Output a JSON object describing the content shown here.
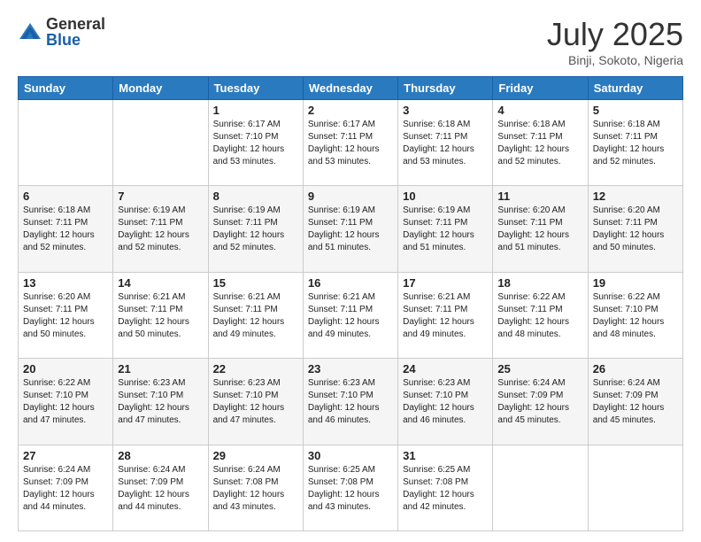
{
  "header": {
    "logo_general": "General",
    "logo_blue": "Blue",
    "month_title": "July 2025",
    "location": "Binji, Sokoto, Nigeria"
  },
  "days_of_week": [
    "Sunday",
    "Monday",
    "Tuesday",
    "Wednesday",
    "Thursday",
    "Friday",
    "Saturday"
  ],
  "weeks": [
    [
      {
        "day": "",
        "sunrise": "",
        "sunset": "",
        "daylight": ""
      },
      {
        "day": "",
        "sunrise": "",
        "sunset": "",
        "daylight": ""
      },
      {
        "day": "1",
        "sunrise": "Sunrise: 6:17 AM",
        "sunset": "Sunset: 7:10 PM",
        "daylight": "Daylight: 12 hours and 53 minutes."
      },
      {
        "day": "2",
        "sunrise": "Sunrise: 6:17 AM",
        "sunset": "Sunset: 7:11 PM",
        "daylight": "Daylight: 12 hours and 53 minutes."
      },
      {
        "day": "3",
        "sunrise": "Sunrise: 6:18 AM",
        "sunset": "Sunset: 7:11 PM",
        "daylight": "Daylight: 12 hours and 53 minutes."
      },
      {
        "day": "4",
        "sunrise": "Sunrise: 6:18 AM",
        "sunset": "Sunset: 7:11 PM",
        "daylight": "Daylight: 12 hours and 52 minutes."
      },
      {
        "day": "5",
        "sunrise": "Sunrise: 6:18 AM",
        "sunset": "Sunset: 7:11 PM",
        "daylight": "Daylight: 12 hours and 52 minutes."
      }
    ],
    [
      {
        "day": "6",
        "sunrise": "Sunrise: 6:18 AM",
        "sunset": "Sunset: 7:11 PM",
        "daylight": "Daylight: 12 hours and 52 minutes."
      },
      {
        "day": "7",
        "sunrise": "Sunrise: 6:19 AM",
        "sunset": "Sunset: 7:11 PM",
        "daylight": "Daylight: 12 hours and 52 minutes."
      },
      {
        "day": "8",
        "sunrise": "Sunrise: 6:19 AM",
        "sunset": "Sunset: 7:11 PM",
        "daylight": "Daylight: 12 hours and 52 minutes."
      },
      {
        "day": "9",
        "sunrise": "Sunrise: 6:19 AM",
        "sunset": "Sunset: 7:11 PM",
        "daylight": "Daylight: 12 hours and 51 minutes."
      },
      {
        "day": "10",
        "sunrise": "Sunrise: 6:19 AM",
        "sunset": "Sunset: 7:11 PM",
        "daylight": "Daylight: 12 hours and 51 minutes."
      },
      {
        "day": "11",
        "sunrise": "Sunrise: 6:20 AM",
        "sunset": "Sunset: 7:11 PM",
        "daylight": "Daylight: 12 hours and 51 minutes."
      },
      {
        "day": "12",
        "sunrise": "Sunrise: 6:20 AM",
        "sunset": "Sunset: 7:11 PM",
        "daylight": "Daylight: 12 hours and 50 minutes."
      }
    ],
    [
      {
        "day": "13",
        "sunrise": "Sunrise: 6:20 AM",
        "sunset": "Sunset: 7:11 PM",
        "daylight": "Daylight: 12 hours and 50 minutes."
      },
      {
        "day": "14",
        "sunrise": "Sunrise: 6:21 AM",
        "sunset": "Sunset: 7:11 PM",
        "daylight": "Daylight: 12 hours and 50 minutes."
      },
      {
        "day": "15",
        "sunrise": "Sunrise: 6:21 AM",
        "sunset": "Sunset: 7:11 PM",
        "daylight": "Daylight: 12 hours and 49 minutes."
      },
      {
        "day": "16",
        "sunrise": "Sunrise: 6:21 AM",
        "sunset": "Sunset: 7:11 PM",
        "daylight": "Daylight: 12 hours and 49 minutes."
      },
      {
        "day": "17",
        "sunrise": "Sunrise: 6:21 AM",
        "sunset": "Sunset: 7:11 PM",
        "daylight": "Daylight: 12 hours and 49 minutes."
      },
      {
        "day": "18",
        "sunrise": "Sunrise: 6:22 AM",
        "sunset": "Sunset: 7:11 PM",
        "daylight": "Daylight: 12 hours and 48 minutes."
      },
      {
        "day": "19",
        "sunrise": "Sunrise: 6:22 AM",
        "sunset": "Sunset: 7:10 PM",
        "daylight": "Daylight: 12 hours and 48 minutes."
      }
    ],
    [
      {
        "day": "20",
        "sunrise": "Sunrise: 6:22 AM",
        "sunset": "Sunset: 7:10 PM",
        "daylight": "Daylight: 12 hours and 47 minutes."
      },
      {
        "day": "21",
        "sunrise": "Sunrise: 6:23 AM",
        "sunset": "Sunset: 7:10 PM",
        "daylight": "Daylight: 12 hours and 47 minutes."
      },
      {
        "day": "22",
        "sunrise": "Sunrise: 6:23 AM",
        "sunset": "Sunset: 7:10 PM",
        "daylight": "Daylight: 12 hours and 47 minutes."
      },
      {
        "day": "23",
        "sunrise": "Sunrise: 6:23 AM",
        "sunset": "Sunset: 7:10 PM",
        "daylight": "Daylight: 12 hours and 46 minutes."
      },
      {
        "day": "24",
        "sunrise": "Sunrise: 6:23 AM",
        "sunset": "Sunset: 7:10 PM",
        "daylight": "Daylight: 12 hours and 46 minutes."
      },
      {
        "day": "25",
        "sunrise": "Sunrise: 6:24 AM",
        "sunset": "Sunset: 7:09 PM",
        "daylight": "Daylight: 12 hours and 45 minutes."
      },
      {
        "day": "26",
        "sunrise": "Sunrise: 6:24 AM",
        "sunset": "Sunset: 7:09 PM",
        "daylight": "Daylight: 12 hours and 45 minutes."
      }
    ],
    [
      {
        "day": "27",
        "sunrise": "Sunrise: 6:24 AM",
        "sunset": "Sunset: 7:09 PM",
        "daylight": "Daylight: 12 hours and 44 minutes."
      },
      {
        "day": "28",
        "sunrise": "Sunrise: 6:24 AM",
        "sunset": "Sunset: 7:09 PM",
        "daylight": "Daylight: 12 hours and 44 minutes."
      },
      {
        "day": "29",
        "sunrise": "Sunrise: 6:24 AM",
        "sunset": "Sunset: 7:08 PM",
        "daylight": "Daylight: 12 hours and 43 minutes."
      },
      {
        "day": "30",
        "sunrise": "Sunrise: 6:25 AM",
        "sunset": "Sunset: 7:08 PM",
        "daylight": "Daylight: 12 hours and 43 minutes."
      },
      {
        "day": "31",
        "sunrise": "Sunrise: 6:25 AM",
        "sunset": "Sunset: 7:08 PM",
        "daylight": "Daylight: 12 hours and 42 minutes."
      },
      {
        "day": "",
        "sunrise": "",
        "sunset": "",
        "daylight": ""
      },
      {
        "day": "",
        "sunrise": "",
        "sunset": "",
        "daylight": ""
      }
    ]
  ]
}
